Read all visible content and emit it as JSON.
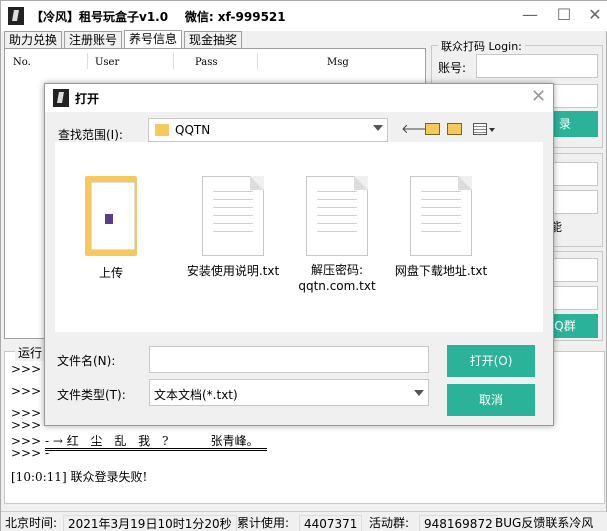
{
  "app": {
    "title": "【冷风】租号玩盒子v1.0",
    "wechat": "微信: xf-999521",
    "min_glyph": "—",
    "max_glyph": "☐",
    "close_glyph": "✕"
  },
  "tabs": [
    "助力兑换",
    "注册账号",
    "养号信息",
    "现金抽奖"
  ],
  "table": {
    "columns": [
      "No.",
      "User",
      "Pass",
      "Msg"
    ]
  },
  "login_group": {
    "title": "联众打码 Login:",
    "account_label": "账号:",
    "login_button": "录",
    "partial_label_1": "能",
    "qq_group_button": "Q群"
  },
  "log": {
    "title": "运行日",
    "lines": [
      ">>> - ",
      ">>> - ",
      ">>> - ",
      ">>> - "
    ],
    "motto_prefix": ">>> - → ",
    "motto": "红 尘 乱 我 ?",
    "motto_author": "张青峰。",
    "motto_bottom_prefix": ">>> - ",
    "last_time": "[10:0:11]",
    "last_msg": "联众登录失败!"
  },
  "status": {
    "time_label": "北京时间:",
    "time_value": "2021年3月19日10时1分20秒",
    "usage_label": "累计使用:",
    "usage_value": "4407371",
    "group_label": "活动群:",
    "group_value": "948169872",
    "feedback": "BUG反馈联系冷风"
  },
  "dialog": {
    "title": "打开",
    "lookin_label": "查找范围(I):",
    "lookin_value": "QQTN",
    "files": [
      {
        "name": "上传",
        "type": "folder"
      },
      {
        "name": "安装使用说明.txt",
        "type": "txt"
      },
      {
        "name": "解压密码:\nqqtn.com.txt",
        "type": "txt"
      },
      {
        "name": "网盘下载地址.txt",
        "type": "txt"
      }
    ],
    "filename_label": "文件名(N):",
    "filename_value": "",
    "filetype_label": "文件类型(T):",
    "filetype_value": "文本文档(*.txt)",
    "open_button": "打开(O)",
    "cancel_button": "取消"
  },
  "colors": {
    "accent": "#2bb39a",
    "folder": "#f5c95c"
  }
}
